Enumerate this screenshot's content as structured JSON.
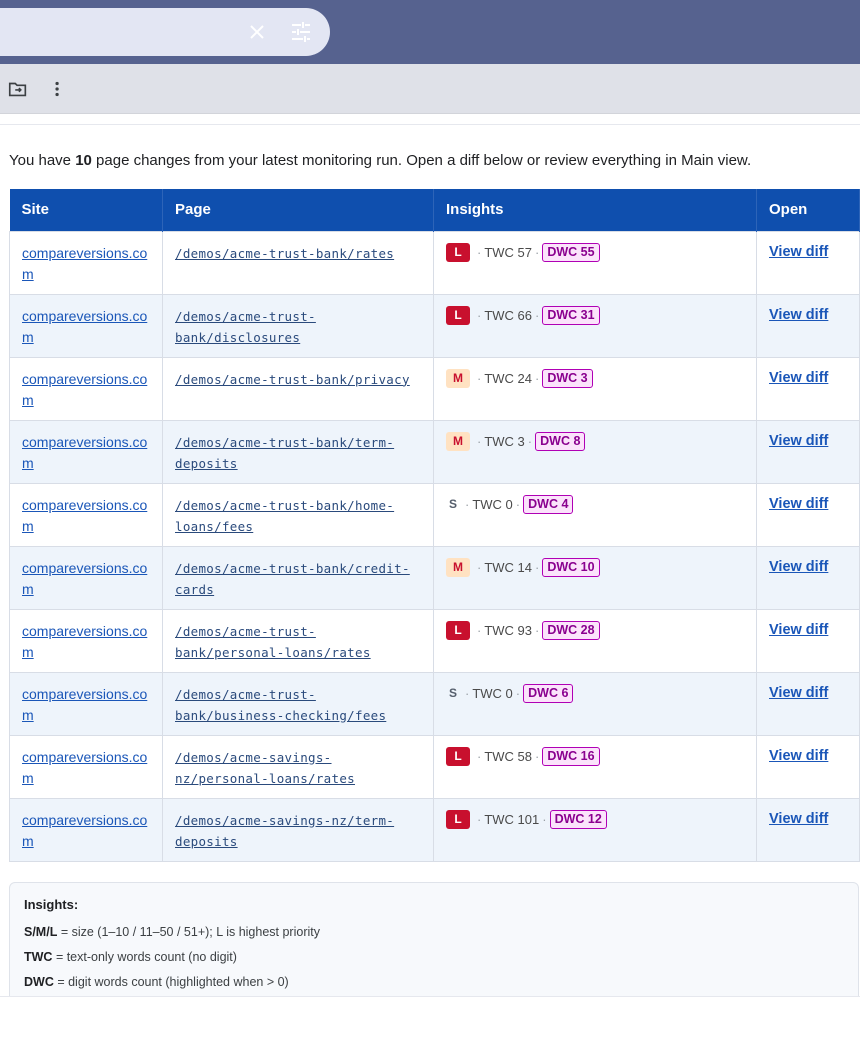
{
  "intro": {
    "prefix": "You have ",
    "count": "10",
    "suffix": " page changes from your latest monitoring run. Open a diff below or review everything in Main view."
  },
  "table": {
    "headers": [
      "Site",
      "Page",
      "Insights",
      "Open"
    ],
    "rows": [
      {
        "site": "compareversions.com",
        "page": "/demos/acme-trust-bank/rates",
        "size": "L",
        "twc": "TWC 57",
        "dwc": "DWC 55",
        "open": "View diff"
      },
      {
        "site": "compareversions.com",
        "page": "/demos/acme-trust-bank/disclosures",
        "size": "L",
        "twc": "TWC 66",
        "dwc": "DWC 31",
        "open": "View diff"
      },
      {
        "site": "compareversions.com",
        "page": "/demos/acme-trust-bank/privacy",
        "size": "M",
        "twc": "TWC 24",
        "dwc": "DWC 3",
        "open": "View diff"
      },
      {
        "site": "compareversions.com",
        "page": "/demos/acme-trust-bank/term-deposits",
        "size": "M",
        "twc": "TWC 3",
        "dwc": "DWC 8",
        "open": "View diff"
      },
      {
        "site": "compareversions.com",
        "page": "/demos/acme-trust-bank/home-loans/fees",
        "size": "S",
        "twc": "TWC 0",
        "dwc": "DWC 4",
        "open": "View diff"
      },
      {
        "site": "compareversions.com",
        "page": "/demos/acme-trust-bank/credit-cards",
        "size": "M",
        "twc": "TWC 14",
        "dwc": "DWC 10",
        "open": "View diff"
      },
      {
        "site": "compareversions.com",
        "page": "/demos/acme-trust-bank/personal-loans/rates",
        "size": "L",
        "twc": "TWC 93",
        "dwc": "DWC 28",
        "open": "View diff"
      },
      {
        "site": "compareversions.com",
        "page": "/demos/acme-trust-bank/business-checking/fees",
        "size": "S",
        "twc": "TWC 0",
        "dwc": "DWC 6",
        "open": "View diff"
      },
      {
        "site": "compareversions.com",
        "page": "/demos/acme-savings-nz/personal-loans/rates",
        "size": "L",
        "twc": "TWC 58",
        "dwc": "DWC 16",
        "open": "View diff"
      },
      {
        "site": "compareversions.com",
        "page": "/demos/acme-savings-nz/term-deposits",
        "size": "L",
        "twc": "TWC 101",
        "dwc": "DWC 12",
        "open": "View diff"
      }
    ]
  },
  "legend": {
    "heading": "Insights:",
    "items": [
      {
        "key": "S/M/L",
        "text": " = size (1–10 / 11–50 / 51+); L is highest priority"
      },
      {
        "key": "TWC",
        "text": " = text-only words count (no digit)"
      },
      {
        "key": "DWC",
        "text": " = digit words count (highlighted when > 0)"
      }
    ]
  },
  "icons": {
    "clear": "close-icon",
    "tune": "tune-icon",
    "move": "move-to-folder-icon",
    "more": "more-vert-icon"
  },
  "colors": {
    "header_bg": "#0f4fae",
    "link": "#1a56b8",
    "size_L": "#c8102e",
    "size_M_bg": "#ffe2c2",
    "dwc_border": "#b000b5"
  }
}
